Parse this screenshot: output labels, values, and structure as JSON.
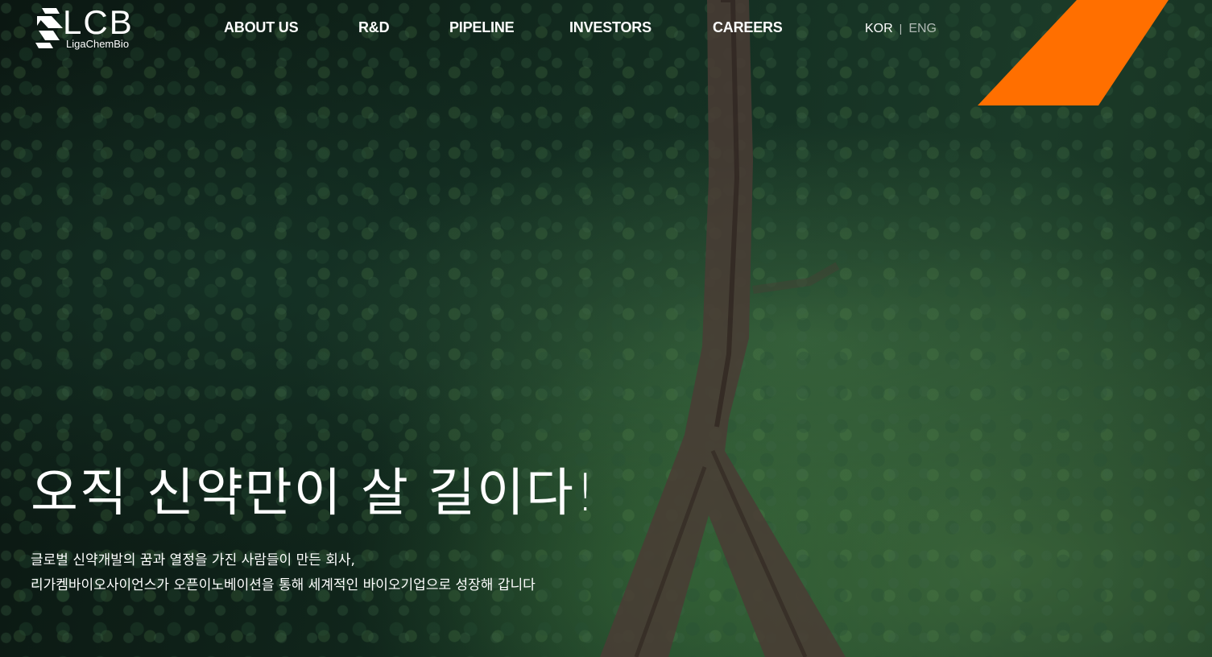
{
  "brand": {
    "logo_text": "LCB",
    "logo_subtext": "LigaChemBio"
  },
  "nav": {
    "items": [
      {
        "label": "ABOUT US"
      },
      {
        "label": "R&D"
      },
      {
        "label": "PIPELINE"
      },
      {
        "label": "INVESTORS"
      },
      {
        "label": "CAREERS"
      }
    ]
  },
  "language": {
    "kor": "KOR",
    "separator": "|",
    "eng": "ENG"
  },
  "hero": {
    "headline": "오직 신약만이 살 길이다!",
    "subline_1": "글로벌 신약개발의 꿈과 열정을 가진 사람들이 만든 회사,",
    "subline_2": "리가켐바이오사이언스가 오픈이노베이션을 통해 세계적인 바이오기업으로 성장해 갑니다"
  },
  "colors": {
    "accent_orange": "#FF6F00",
    "text_white": "#FFFFFF",
    "forest_dark": "#10251B"
  }
}
